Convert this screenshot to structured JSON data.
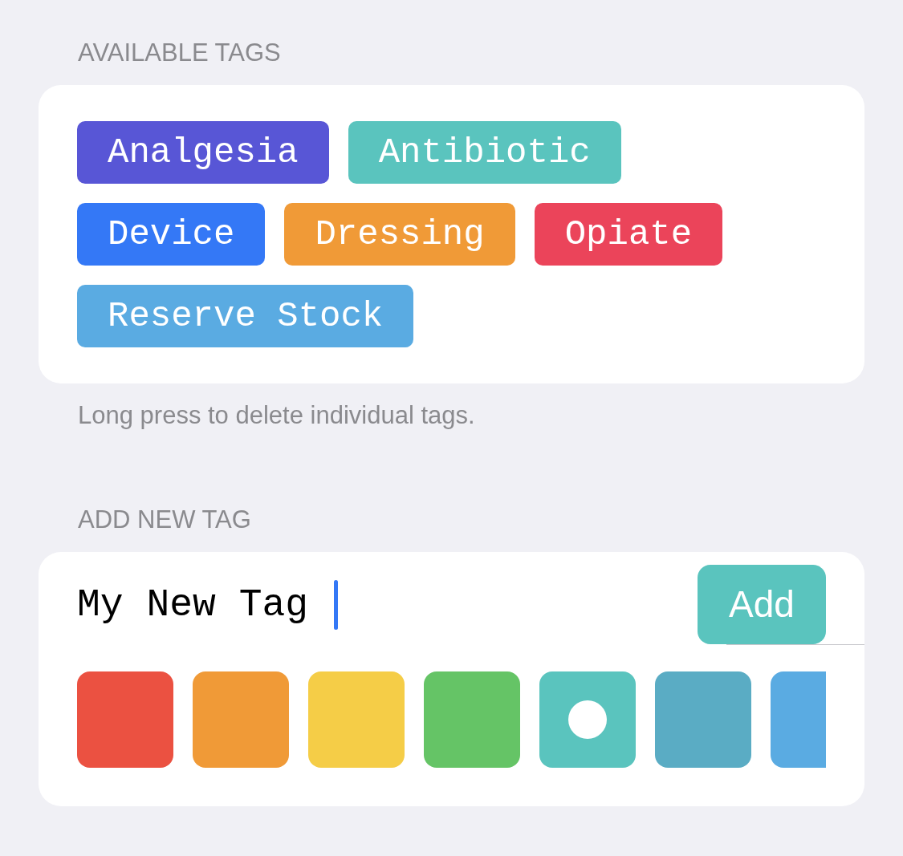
{
  "available_tags": {
    "header": "AVAILABLE TAGS",
    "tags": [
      {
        "label": "Analgesia",
        "color": "#5856d6"
      },
      {
        "label": "Antibiotic",
        "color": "#5ac4be"
      },
      {
        "label": "Device",
        "color": "#3478f6"
      },
      {
        "label": "Dressing",
        "color": "#f09a37"
      },
      {
        "label": "Opiate",
        "color": "#eb445a"
      },
      {
        "label": "Reserve Stock",
        "color": "#5aabe2"
      }
    ],
    "footer": "Long press to delete individual tags."
  },
  "add_new_tag": {
    "header": "ADD NEW TAG",
    "field": {
      "value": "My New Tag",
      "focused": true
    },
    "add_button": "Add",
    "swatches": [
      {
        "color": "#eb5141",
        "selected": false
      },
      {
        "color": "#f09a37",
        "selected": false
      },
      {
        "color": "#f5cd47",
        "selected": false
      },
      {
        "color": "#65c466",
        "selected": false
      },
      {
        "color": "#5ac4be",
        "selected": true
      },
      {
        "color": "#5aacc4",
        "selected": false
      },
      {
        "color": "#5aabe2",
        "selected": false
      }
    ]
  }
}
